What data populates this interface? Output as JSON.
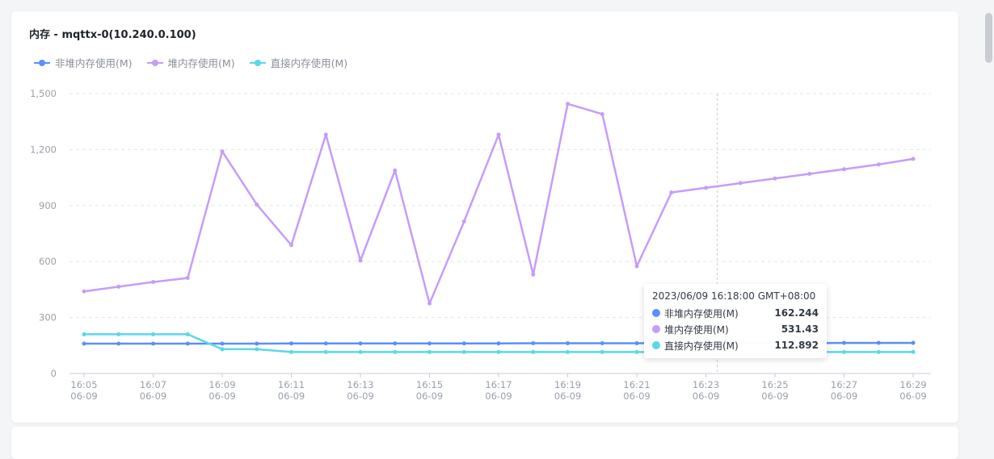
{
  "panel": {
    "title": "内存 - mqttx-0(10.240.0.100)"
  },
  "legend": [
    {
      "label": "非堆内存使用(M)",
      "color": "#5b8ff9"
    },
    {
      "label": "堆内存使用(M)",
      "color": "#c69cf8"
    },
    {
      "label": "直接内存使用(M)",
      "color": "#5ad8e6"
    }
  ],
  "tooltip": {
    "title": "2023/06/09 16:18:00 GMT+08:00",
    "rows": [
      {
        "name": "非堆内存使用(M)",
        "value": "162.244",
        "color": "#5b8ff9"
      },
      {
        "name": "堆内存使用(M)",
        "value": "531.43",
        "color": "#c69cf8"
      },
      {
        "name": "直接内存使用(M)",
        "value": "112.892",
        "color": "#5ad8e6"
      }
    ]
  },
  "chart_data": {
    "type": "line",
    "title": "内存 - mqttx-0(10.240.0.100)",
    "x": [
      "16:05",
      "16:06",
      "16:07",
      "16:08",
      "16:09",
      "16:10",
      "16:11",
      "16:12",
      "16:13",
      "16:14",
      "16:15",
      "16:16",
      "16:17",
      "16:18",
      "16:19",
      "16:20",
      "16:21",
      "16:22",
      "16:23",
      "16:24",
      "16:25",
      "16:26",
      "16:27",
      "16:28",
      "16:29"
    ],
    "x_tick_labels": [
      {
        "time": "16:05",
        "date": "06-09"
      },
      {
        "time": "16:07",
        "date": "06-09"
      },
      {
        "time": "16:09",
        "date": "06-09"
      },
      {
        "time": "16:11",
        "date": "06-09"
      },
      {
        "time": "16:13",
        "date": "06-09"
      },
      {
        "time": "16:15",
        "date": "06-09"
      },
      {
        "time": "16:17",
        "date": "06-09"
      },
      {
        "time": "16:19",
        "date": "06-09"
      },
      {
        "time": "16:21",
        "date": "06-09"
      },
      {
        "time": "16:23",
        "date": "06-09"
      },
      {
        "time": "16:25",
        "date": "06-09"
      },
      {
        "time": "16:27",
        "date": "06-09"
      },
      {
        "time": "16:29",
        "date": "06-09"
      }
    ],
    "y_ticks": [
      0,
      300,
      600,
      900,
      1200,
      1500
    ],
    "y_tick_labels": [
      "0",
      "300",
      "600",
      "900",
      "1,200",
      "1,500"
    ],
    "ylim": [
      0,
      1500
    ],
    "grid": true,
    "legend_position": "top-left",
    "hover_x": "16:23",
    "series": [
      {
        "name": "非堆内存使用(M)",
        "color": "#5b8ff9",
        "values": [
          160,
          160,
          160,
          160,
          160,
          160,
          161,
          161,
          161,
          161,
          161,
          161,
          161,
          162,
          162,
          162,
          162,
          163,
          163,
          163,
          163,
          163,
          164,
          164,
          164
        ]
      },
      {
        "name": "堆内存使用(M)",
        "color": "#c69cf8",
        "values": [
          440,
          465,
          490,
          512,
          1190,
          905,
          688,
          1280,
          605,
          1088,
          375,
          815,
          1280,
          530,
          1445,
          1390,
          575,
          970,
          995,
          1020,
          1045,
          1070,
          1095,
          1120,
          1150
        ]
      },
      {
        "name": "直接内存使用(M)",
        "color": "#5ad8e6",
        "values": [
          210,
          210,
          210,
          210,
          130,
          130,
          115,
          115,
          115,
          115,
          115,
          115,
          115,
          115,
          115,
          115,
          115,
          115,
          115,
          115,
          115,
          115,
          115,
          115,
          115
        ]
      }
    ]
  }
}
